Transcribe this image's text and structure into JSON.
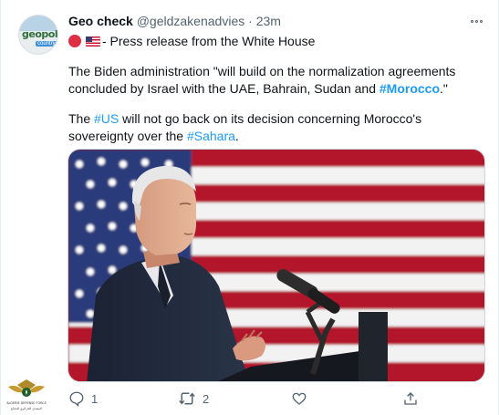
{
  "tweet": {
    "author_name": "Geo check",
    "author_handle": "@geldzakenadvies",
    "separator": "·",
    "time": "23m",
    "avatar_text": "geopoli",
    "avatar_subtext": "country",
    "line1_text": "- Press release from the White House",
    "paragraph1": {
      "before": " The Biden administration \"will build on the normalization agreements concluded by Israel with the UAE, Bahrain, Sudan and ",
      "hashtag": "#Morocco",
      "after": ".\""
    },
    "paragraph2": {
      "before": " The ",
      "hashtag1": "#US",
      "middle": " will not go back on its decision concerning Morocco's sovereignty over the ",
      "hashtag2": "#Sahara",
      "after": "."
    }
  },
  "actions": {
    "reply_count": "1",
    "retweet_count": "2"
  },
  "icons": {
    "more": "more-horizontal-icon",
    "reply": "reply-icon",
    "retweet": "retweet-icon",
    "like": "heart-icon",
    "share": "share-icon"
  },
  "colors": {
    "link": "#1d9bf0",
    "text": "#0f1419",
    "muted": "#536471"
  },
  "watermark": {
    "line1": "ALGERIE DEFENSE FORCE",
    "line2": "المنتدى الجزائري للدفاع"
  }
}
